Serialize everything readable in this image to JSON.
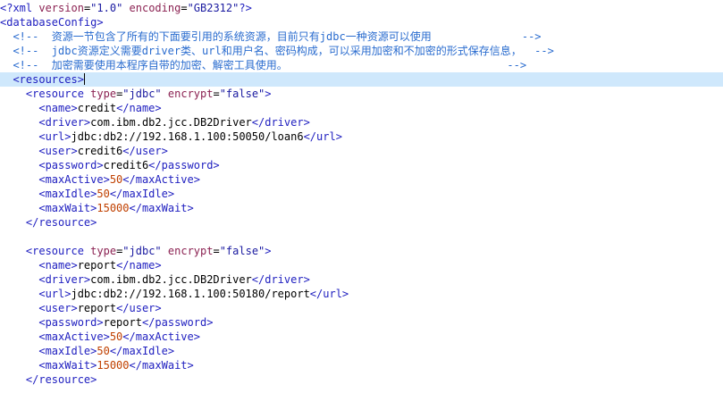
{
  "editor": {
    "language": "xml",
    "current_line": 5,
    "colors": {
      "tag": "#2020c0",
      "attr_name": "#8b2252",
      "attr_value": "#1a1aa0",
      "text": "#000000",
      "comment": "#2a6ccf",
      "number": "#c04000",
      "current_line_bg": "#cfe8fc"
    },
    "lines": [
      [
        {
          "t": "<?xml ",
          "k": "tag"
        },
        {
          "t": "version",
          "k": "attr_name"
        },
        {
          "t": "=",
          "k": "text"
        },
        {
          "t": "\"1.0\"",
          "k": "attr_value"
        },
        {
          "t": " ",
          "k": "text"
        },
        {
          "t": "encoding",
          "k": "attr_name"
        },
        {
          "t": "=",
          "k": "text"
        },
        {
          "t": "\"GB2312\"",
          "k": "attr_value"
        },
        {
          "t": "?>",
          "k": "tag"
        }
      ],
      [
        {
          "t": "<databaseConfig>",
          "k": "tag"
        }
      ],
      [
        {
          "t": "  <!--  资源一节包含了所有的下面要引用的系统资源，目前只有jdbc一种资源可以使用              -->",
          "k": "comment"
        }
      ],
      [
        {
          "t": "  <!--  jdbc资源定义需要driver类、url和用户名、密码构成，可以采用加密和不加密的形式保存信息，  -->",
          "k": "comment"
        }
      ],
      [
        {
          "t": "  <!--  加密需要使用本程序自带的加密、解密工具使用。                                  -->",
          "k": "comment"
        }
      ],
      [
        {
          "t": "  <resources>",
          "k": "tag"
        }
      ],
      [
        {
          "t": "    <resource ",
          "k": "tag"
        },
        {
          "t": "type",
          "k": "attr_name"
        },
        {
          "t": "=",
          "k": "text"
        },
        {
          "t": "\"jdbc\"",
          "k": "attr_value"
        },
        {
          "t": " ",
          "k": "text"
        },
        {
          "t": "encrypt",
          "k": "attr_name"
        },
        {
          "t": "=",
          "k": "text"
        },
        {
          "t": "\"false\"",
          "k": "attr_value"
        },
        {
          "t": ">",
          "k": "tag"
        }
      ],
      [
        {
          "t": "      <name>",
          "k": "tag"
        },
        {
          "t": "credit",
          "k": "text"
        },
        {
          "t": "</name>",
          "k": "tag"
        }
      ],
      [
        {
          "t": "      <driver>",
          "k": "tag"
        },
        {
          "t": "com.ibm.db2.jcc.DB2Driver",
          "k": "text"
        },
        {
          "t": "</driver>",
          "k": "tag"
        }
      ],
      [
        {
          "t": "      <url>",
          "k": "tag"
        },
        {
          "t": "jdbc:db2://192.168.1.100:50050/loan6",
          "k": "text"
        },
        {
          "t": "</url>",
          "k": "tag"
        }
      ],
      [
        {
          "t": "      <user>",
          "k": "tag"
        },
        {
          "t": "credit6",
          "k": "text"
        },
        {
          "t": "</user>",
          "k": "tag"
        }
      ],
      [
        {
          "t": "      <password>",
          "k": "tag"
        },
        {
          "t": "credit6",
          "k": "text"
        },
        {
          "t": "</password>",
          "k": "tag"
        }
      ],
      [
        {
          "t": "      <maxActive>",
          "k": "tag"
        },
        {
          "t": "50",
          "k": "number"
        },
        {
          "t": "</maxActive>",
          "k": "tag"
        }
      ],
      [
        {
          "t": "      <maxIdle>",
          "k": "tag"
        },
        {
          "t": "50",
          "k": "number"
        },
        {
          "t": "</maxIdle>",
          "k": "tag"
        }
      ],
      [
        {
          "t": "      <maxWait>",
          "k": "tag"
        },
        {
          "t": "15000",
          "k": "number"
        },
        {
          "t": "</maxWait>",
          "k": "tag"
        }
      ],
      [
        {
          "t": "    </resource>",
          "k": "tag"
        }
      ],
      [],
      [
        {
          "t": "    <resource ",
          "k": "tag"
        },
        {
          "t": "type",
          "k": "attr_name"
        },
        {
          "t": "=",
          "k": "text"
        },
        {
          "t": "\"jdbc\"",
          "k": "attr_value"
        },
        {
          "t": " ",
          "k": "text"
        },
        {
          "t": "encrypt",
          "k": "attr_name"
        },
        {
          "t": "=",
          "k": "text"
        },
        {
          "t": "\"false\"",
          "k": "attr_value"
        },
        {
          "t": ">",
          "k": "tag"
        }
      ],
      [
        {
          "t": "      <name>",
          "k": "tag"
        },
        {
          "t": "report",
          "k": "text"
        },
        {
          "t": "</name>",
          "k": "tag"
        }
      ],
      [
        {
          "t": "      <driver>",
          "k": "tag"
        },
        {
          "t": "com.ibm.db2.jcc.DB2Driver",
          "k": "text"
        },
        {
          "t": "</driver>",
          "k": "tag"
        }
      ],
      [
        {
          "t": "      <url>",
          "k": "tag"
        },
        {
          "t": "jdbc:db2://192.168.1.100:50180/report",
          "k": "text"
        },
        {
          "t": "</url>",
          "k": "tag"
        }
      ],
      [
        {
          "t": "      <user>",
          "k": "tag"
        },
        {
          "t": "report",
          "k": "text"
        },
        {
          "t": "</user>",
          "k": "tag"
        }
      ],
      [
        {
          "t": "      <password>",
          "k": "tag"
        },
        {
          "t": "report",
          "k": "text"
        },
        {
          "t": "</password>",
          "k": "tag"
        }
      ],
      [
        {
          "t": "      <maxActive>",
          "k": "tag"
        },
        {
          "t": "50",
          "k": "number"
        },
        {
          "t": "</maxActive>",
          "k": "tag"
        }
      ],
      [
        {
          "t": "      <maxIdle>",
          "k": "tag"
        },
        {
          "t": "50",
          "k": "number"
        },
        {
          "t": "</maxIdle>",
          "k": "tag"
        }
      ],
      [
        {
          "t": "      <maxWait>",
          "k": "tag"
        },
        {
          "t": "15000",
          "k": "number"
        },
        {
          "t": "</maxWait>",
          "k": "tag"
        }
      ],
      [
        {
          "t": "    </resource>",
          "k": "tag"
        }
      ]
    ]
  }
}
